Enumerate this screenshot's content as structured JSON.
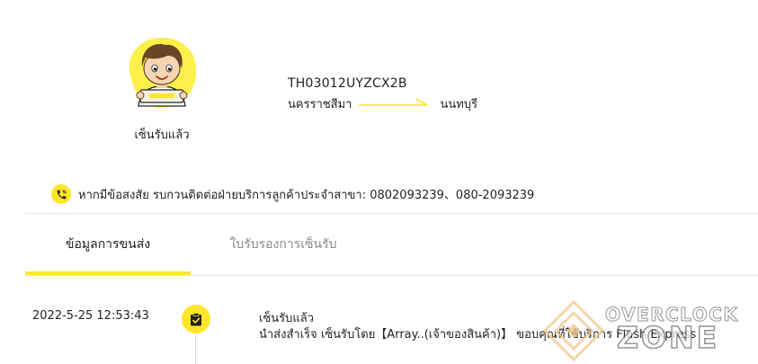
{
  "header": {
    "status_label": "เซ็นรับแล้ว",
    "tracking_number": "TH03012UYZCX2B",
    "origin": "นครราชสีมา",
    "destination": "นนทบุรี"
  },
  "notice": {
    "icon": "phone-icon",
    "text": "หากมีข้อสงสัย รบกวนติดต่อฝ่ายบริการลูกค้าประจำสาขา: 0802093239、080-2093239"
  },
  "tabs": [
    {
      "label": "ข้อมูลการขนส่ง",
      "active": true
    },
    {
      "label": "ใบรับรองการเซ็นรับ",
      "active": false
    }
  ],
  "timeline": [
    {
      "time": "2022-5-25 12:53:43",
      "icon": "clipboard-check-icon",
      "title": "เซ็นรับแล้ว",
      "description": "นำส่งสำเร็จ เซ็นรับโดย【Array..(เจ้าของสินค้า)】 ขอบคุณที่ใช้บริการ Flash Express"
    }
  ],
  "watermark": {
    "line1": "OVERCLOCK",
    "line2": "ZONE"
  },
  "colors": {
    "accent": "#ffe628",
    "text": "#222222",
    "muted": "#8a8a8a",
    "divider": "#e6e6e6"
  }
}
